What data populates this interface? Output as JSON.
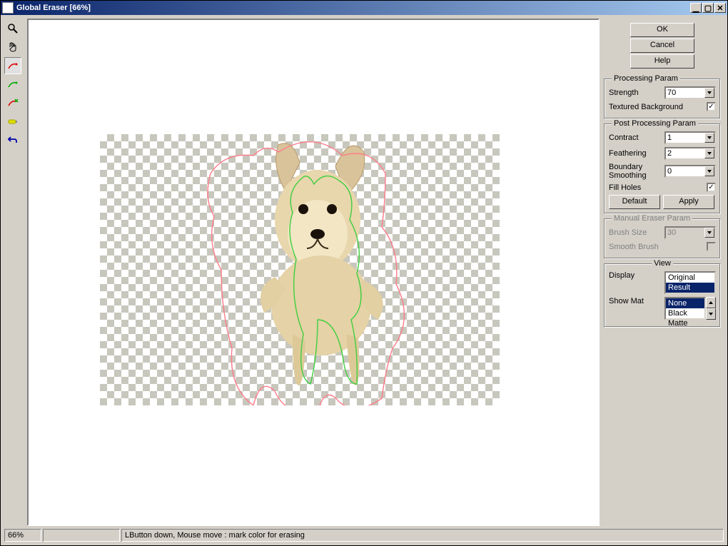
{
  "window": {
    "title": "Global Eraser [66%]",
    "minimize": "_",
    "maximize": "□",
    "close": "×"
  },
  "buttons": {
    "ok": "OK",
    "cancel": "Cancel",
    "help": "Help",
    "default": "Default",
    "apply": "Apply"
  },
  "groups": {
    "processing": "Processing Param",
    "post_processing": "Post Processing Param",
    "manual": "Manual Eraser Param",
    "view": "View"
  },
  "params": {
    "strength_label": "Strength",
    "strength_value": "70",
    "textured_bg_label": "Textured Background",
    "textured_bg_checked": true,
    "contract_label": "Contract",
    "contract_value": "1",
    "feathering_label": "Feathering",
    "feathering_value": "2",
    "boundary_label": "Boundary Smoothing",
    "boundary_value": "0",
    "fill_holes_label": "Fill Holes",
    "fill_holes_checked": true,
    "brush_size_label": "Brush Size",
    "brush_size_value": "30",
    "smooth_brush_label": "Smooth Brush"
  },
  "view": {
    "display_label": "Display",
    "display_options": {
      "original": "Original",
      "result": "Result"
    },
    "display_selected": "Result",
    "show_mat_label": "Show Mat",
    "show_mat_options": {
      "none": "None",
      "black_matte": "Black Matte"
    },
    "show_mat_selected": "None"
  },
  "status": {
    "zoom": "66%",
    "message": "LButton down, Mouse move : mark color for erasing"
  },
  "tool_icons": {
    "zoom": "zoom-icon",
    "hand": "hand-icon",
    "erase_mark": "erase-mark-icon",
    "keep_mark": "keep-mark-icon",
    "remove_mark": "remove-mark-icon",
    "brush": "brush-icon",
    "undo": "undo-icon"
  }
}
